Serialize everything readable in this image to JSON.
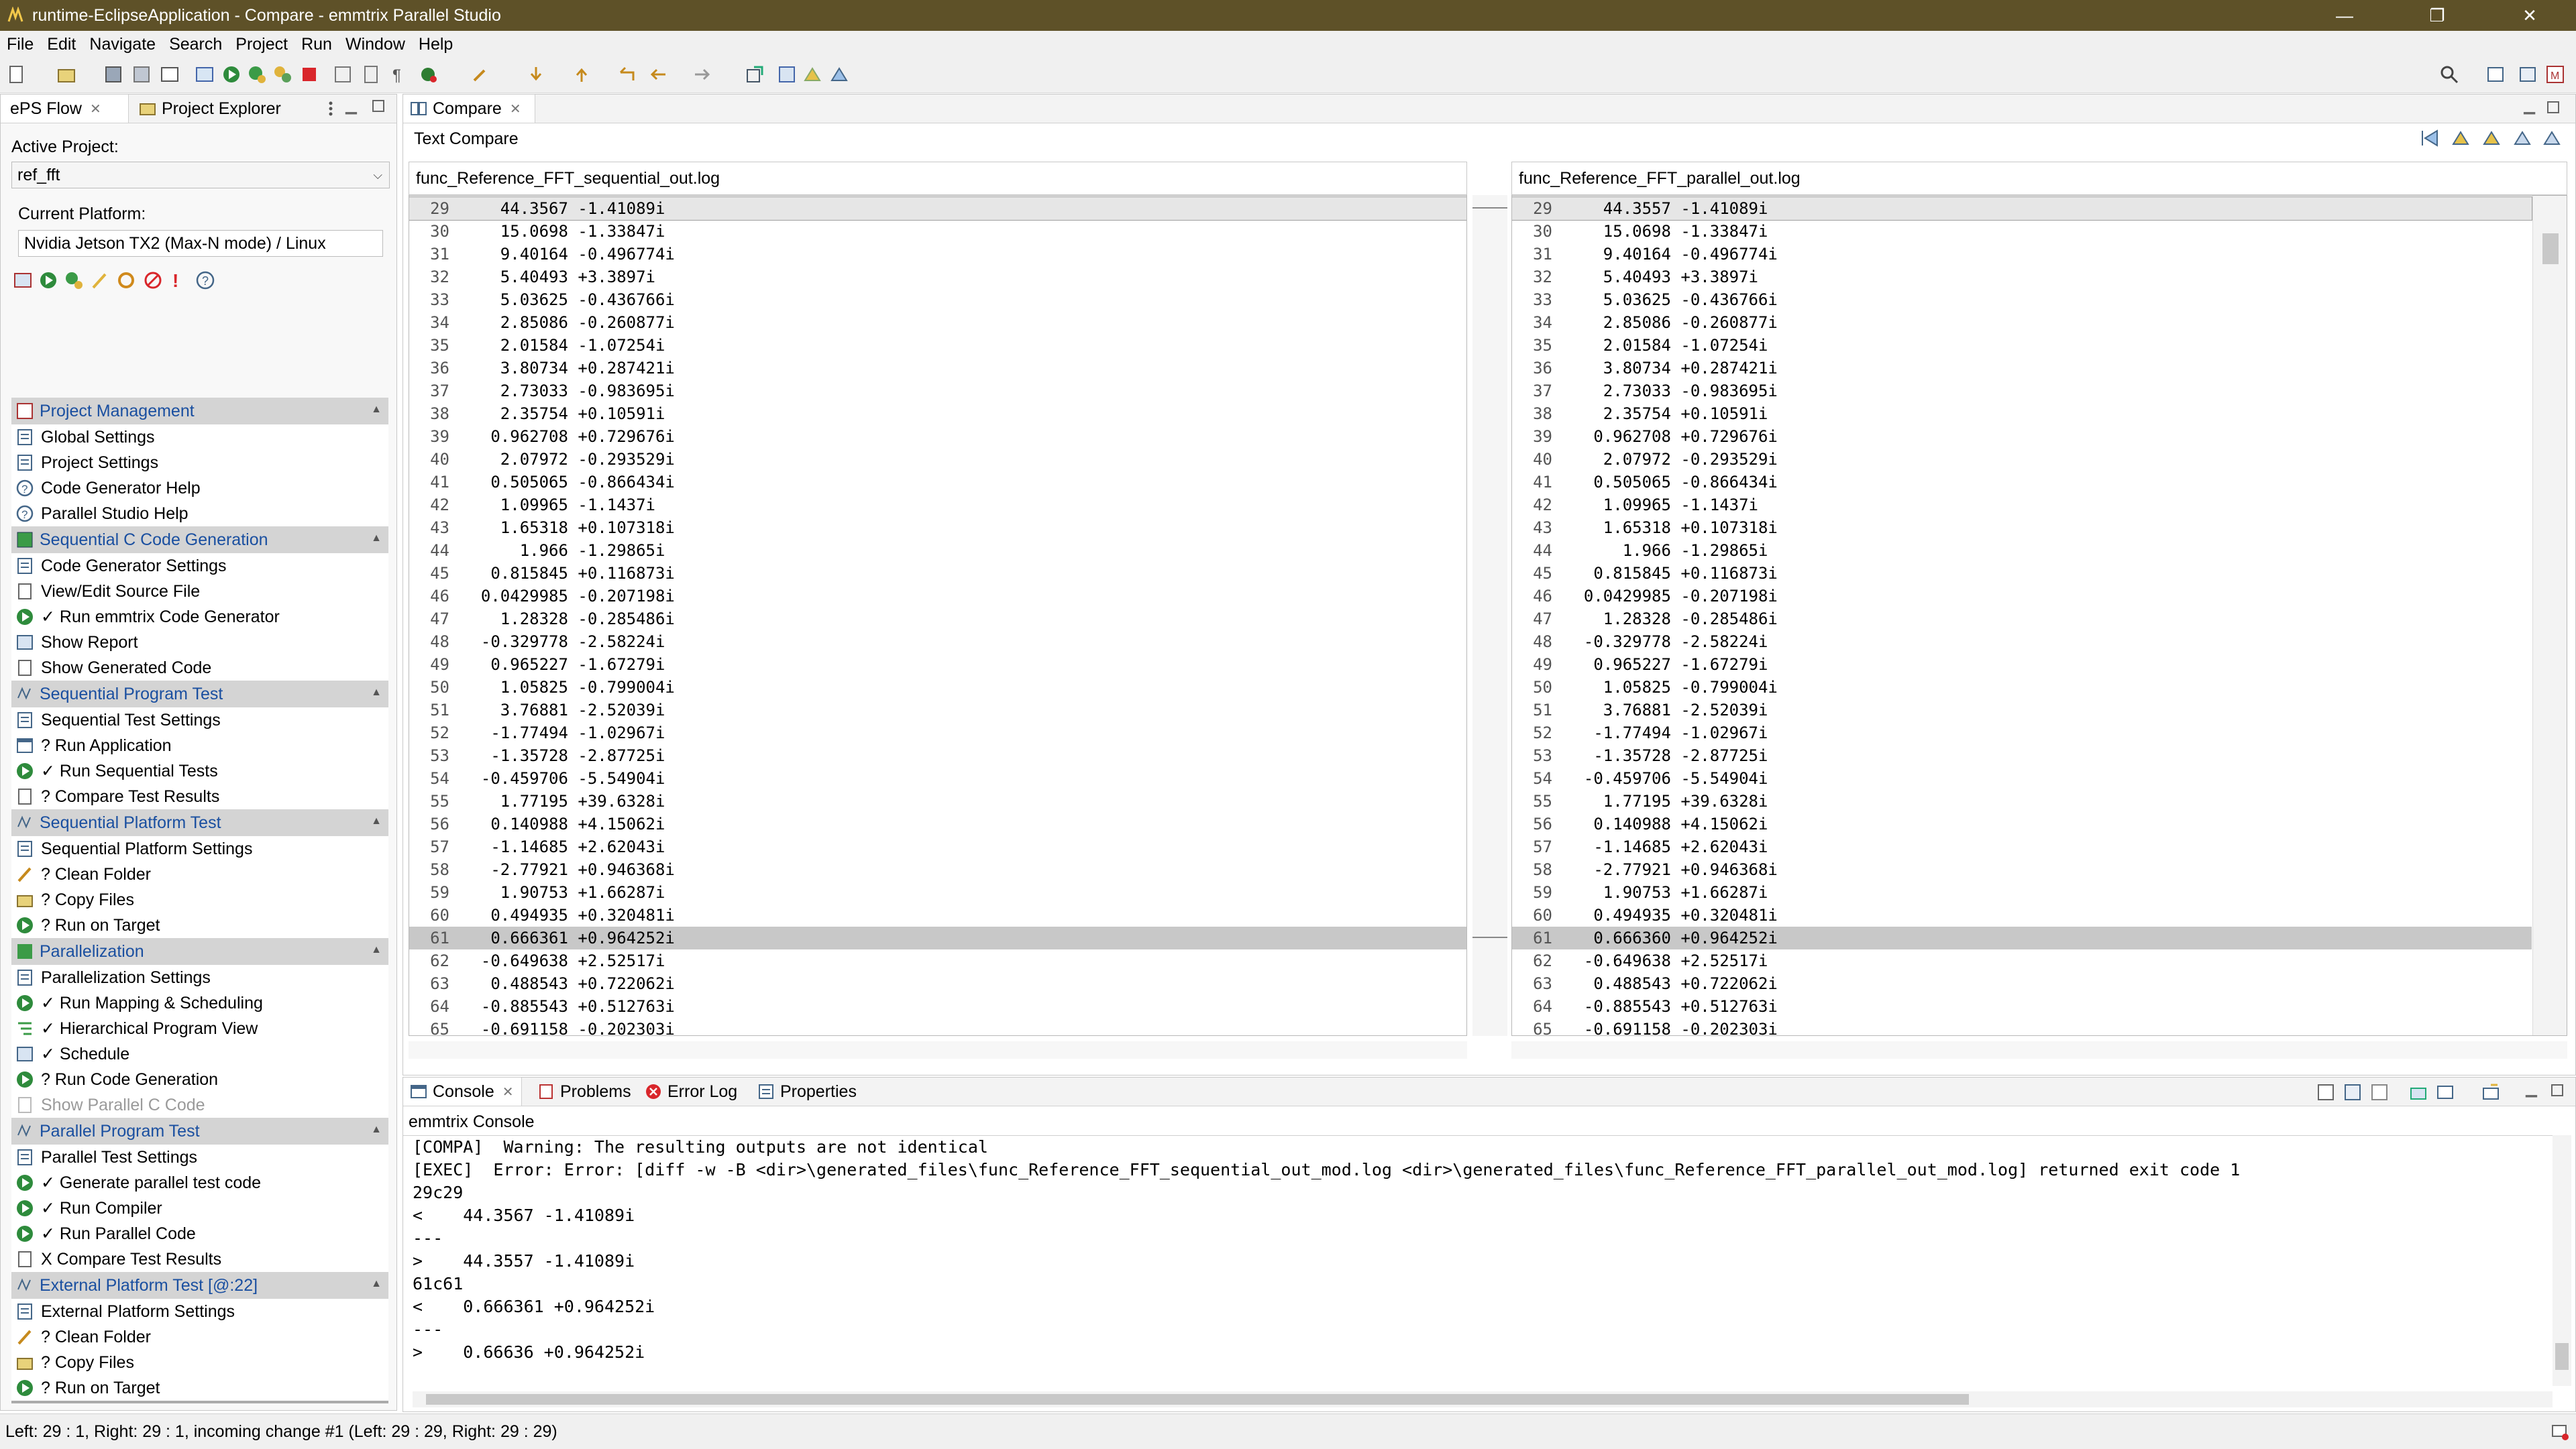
{
  "window": {
    "title": "runtime-EclipseApplication - Compare - emmtrix Parallel Studio",
    "minimize": "—",
    "restore": "❐",
    "close": "✕"
  },
  "menu": [
    "File",
    "Edit",
    "Navigate",
    "Search",
    "Project",
    "Run",
    "Window",
    "Help"
  ],
  "left_panel": {
    "tabs": [
      {
        "label": "ePS Flow"
      },
      {
        "label": "Project Explorer"
      }
    ],
    "active_project_label": "Active Project:",
    "active_project_value": "ref_fft",
    "current_platform_label": "Current Platform:",
    "current_platform_value": "Nvidia Jetson TX2 (Max-N mode) / Linux",
    "sections": [
      {
        "title": "Project Management",
        "items": [
          {
            "label": "Global Settings",
            "icon": "settings-icon"
          },
          {
            "label": "Project Settings",
            "icon": "settings-icon"
          },
          {
            "label": "Code Generator Help",
            "icon": "help-icon"
          },
          {
            "label": "Parallel Studio Help",
            "icon": "help-icon"
          }
        ]
      },
      {
        "title": "Sequential C Code Generation",
        "items": [
          {
            "label": "Code Generator Settings",
            "icon": "settings-icon"
          },
          {
            "label": "View/Edit Source File",
            "icon": "file-icon"
          },
          {
            "label": "✓ Run emmtrix Code Generator",
            "icon": "run-icon"
          },
          {
            "label": "Show Report",
            "icon": "report-icon"
          },
          {
            "label": "Show Generated Code",
            "icon": "file-icon"
          }
        ]
      },
      {
        "title": "Sequential Program Test",
        "items": [
          {
            "label": "Sequential Test Settings",
            "icon": "settings-icon"
          },
          {
            "label": "? Run Application",
            "icon": "app-icon"
          },
          {
            "label": "✓ Run Sequential Tests",
            "icon": "run-icon"
          },
          {
            "label": "? Compare Test Results",
            "icon": "file-icon"
          }
        ]
      },
      {
        "title": "Sequential Platform Test",
        "items": [
          {
            "label": "Sequential Platform Settings",
            "icon": "settings-icon"
          },
          {
            "label": "? Clean Folder",
            "icon": "broom-icon"
          },
          {
            "label": "? Copy Files",
            "icon": "folder-icon"
          },
          {
            "label": "? Run on Target",
            "icon": "run-icon"
          }
        ]
      },
      {
        "title": "Parallelization",
        "items": [
          {
            "label": "Parallelization Settings",
            "icon": "settings-icon"
          },
          {
            "label": "✓ Run Mapping & Scheduling",
            "icon": "run-icon"
          },
          {
            "label": "✓ Hierarchical Program View",
            "icon": "hierarchy-icon"
          },
          {
            "label": "✓ Schedule",
            "icon": "report-icon"
          },
          {
            "label": "? Run Code Generation",
            "icon": "run-icon"
          },
          {
            "label": "Show Parallel C Code",
            "icon": "file-icon",
            "disabled": true
          }
        ]
      },
      {
        "title": "Parallel Program Test",
        "items": [
          {
            "label": "Parallel Test Settings",
            "icon": "settings-icon"
          },
          {
            "label": "✓ Generate parallel test code",
            "icon": "run-icon"
          },
          {
            "label": "✓ Run Compiler",
            "icon": "run-icon"
          },
          {
            "label": "✓ Run Parallel Code",
            "icon": "run-icon"
          },
          {
            "label": "X Compare Test Results",
            "icon": "file-icon"
          }
        ]
      },
      {
        "title": "External Platform Test [@:22]",
        "items": [
          {
            "label": "External Platform Settings",
            "icon": "settings-icon"
          },
          {
            "label": "? Clean Folder",
            "icon": "broom-icon"
          },
          {
            "label": "? Copy Files",
            "icon": "folder-icon"
          },
          {
            "label": "? Run on Target",
            "icon": "run-icon"
          }
        ]
      }
    ]
  },
  "compare": {
    "tab_label": "Compare",
    "header": "Text Compare",
    "left_file": "func_Reference_FFT_sequential_out.log",
    "right_file": "func_Reference_FFT_parallel_out.log",
    "left_lines": [
      {
        "n": "29",
        "t": "    44.3567 -1.41089i"
      },
      {
        "n": "30",
        "t": "    15.0698 -1.33847i"
      },
      {
        "n": "31",
        "t": "    9.40164 -0.496774i"
      },
      {
        "n": "32",
        "t": "    5.40493 +3.3897i"
      },
      {
        "n": "33",
        "t": "    5.03625 -0.436766i"
      },
      {
        "n": "34",
        "t": "    2.85086 -0.260877i"
      },
      {
        "n": "35",
        "t": "    2.01584 -1.07254i"
      },
      {
        "n": "36",
        "t": "    3.80734 +0.287421i"
      },
      {
        "n": "37",
        "t": "    2.73033 -0.983695i"
      },
      {
        "n": "38",
        "t": "    2.35754 +0.10591i"
      },
      {
        "n": "39",
        "t": "   0.962708 +0.729676i"
      },
      {
        "n": "40",
        "t": "    2.07972 -0.293529i"
      },
      {
        "n": "41",
        "t": "   0.505065 -0.866434i"
      },
      {
        "n": "42",
        "t": "    1.09965 -1.1437i"
      },
      {
        "n": "43",
        "t": "    1.65318 +0.107318i"
      },
      {
        "n": "44",
        "t": "      1.966 -1.29865i"
      },
      {
        "n": "45",
        "t": "   0.815845 +0.116873i"
      },
      {
        "n": "46",
        "t": "  0.0429985 -0.207198i"
      },
      {
        "n": "47",
        "t": "    1.28328 -0.285486i"
      },
      {
        "n": "48",
        "t": "  -0.329778 -2.58224i"
      },
      {
        "n": "49",
        "t": "   0.965227 -1.67279i"
      },
      {
        "n": "50",
        "t": "    1.05825 -0.799004i"
      },
      {
        "n": "51",
        "t": "    3.76881 -2.52039i"
      },
      {
        "n": "52",
        "t": "   -1.77494 -1.02967i"
      },
      {
        "n": "53",
        "t": "   -1.35728 -2.87725i"
      },
      {
        "n": "54",
        "t": "  -0.459706 -5.54904i"
      },
      {
        "n": "55",
        "t": "    1.77195 +39.6328i"
      },
      {
        "n": "56",
        "t": "   0.140988 +4.15062i"
      },
      {
        "n": "57",
        "t": "   -1.14685 +2.62043i"
      },
      {
        "n": "58",
        "t": "   -2.77921 +0.946368i"
      },
      {
        "n": "59",
        "t": "    1.90753 +1.66287i"
      },
      {
        "n": "60",
        "t": "   0.494935 +0.320481i"
      },
      {
        "n": "61",
        "t": "   0.666361 +0.964252i"
      },
      {
        "n": "62",
        "t": "  -0.649638 +2.52517i"
      },
      {
        "n": "63",
        "t": "   0.488543 +0.722062i"
      },
      {
        "n": "64",
        "t": "  -0.885543 +0.512763i"
      },
      {
        "n": "65",
        "t": "  -0.691158 -0.202303i"
      }
    ],
    "right_lines": [
      {
        "n": "29",
        "t": "    44.3557 -1.41089i"
      },
      {
        "n": "30",
        "t": "    15.0698 -1.33847i"
      },
      {
        "n": "31",
        "t": "    9.40164 -0.496774i"
      },
      {
        "n": "32",
        "t": "    5.40493 +3.3897i"
      },
      {
        "n": "33",
        "t": "    5.03625 -0.436766i"
      },
      {
        "n": "34",
        "t": "    2.85086 -0.260877i"
      },
      {
        "n": "35",
        "t": "    2.01584 -1.07254i"
      },
      {
        "n": "36",
        "t": "    3.80734 +0.287421i"
      },
      {
        "n": "37",
        "t": "    2.73033 -0.983695i"
      },
      {
        "n": "38",
        "t": "    2.35754 +0.10591i"
      },
      {
        "n": "39",
        "t": "   0.962708 +0.729676i"
      },
      {
        "n": "40",
        "t": "    2.07972 -0.293529i"
      },
      {
        "n": "41",
        "t": "   0.505065 -0.866434i"
      },
      {
        "n": "42",
        "t": "    1.09965 -1.1437i"
      },
      {
        "n": "43",
        "t": "    1.65318 +0.107318i"
      },
      {
        "n": "44",
        "t": "      1.966 -1.29865i"
      },
      {
        "n": "45",
        "t": "   0.815845 +0.116873i"
      },
      {
        "n": "46",
        "t": "  0.0429985 -0.207198i"
      },
      {
        "n": "47",
        "t": "    1.28328 -0.285486i"
      },
      {
        "n": "48",
        "t": "  -0.329778 -2.58224i"
      },
      {
        "n": "49",
        "t": "   0.965227 -1.67279i"
      },
      {
        "n": "50",
        "t": "    1.05825 -0.799004i"
      },
      {
        "n": "51",
        "t": "    3.76881 -2.52039i"
      },
      {
        "n": "52",
        "t": "   -1.77494 -1.02967i"
      },
      {
        "n": "53",
        "t": "   -1.35728 -2.87725i"
      },
      {
        "n": "54",
        "t": "  -0.459706 -5.54904i"
      },
      {
        "n": "55",
        "t": "    1.77195 +39.6328i"
      },
      {
        "n": "56",
        "t": "   0.140988 +4.15062i"
      },
      {
        "n": "57",
        "t": "   -1.14685 +2.62043i"
      },
      {
        "n": "58",
        "t": "   -2.77921 +0.946368i"
      },
      {
        "n": "59",
        "t": "    1.90753 +1.66287i"
      },
      {
        "n": "60",
        "t": "   0.494935 +0.320481i"
      },
      {
        "n": "61",
        "t": "   0.666360 +0.964252i"
      },
      {
        "n": "62",
        "t": "  -0.649638 +2.52517i"
      },
      {
        "n": "63",
        "t": "   0.488543 +0.722062i"
      },
      {
        "n": "64",
        "t": "  -0.885543 +0.512763i"
      },
      {
        "n": "65",
        "t": "  -0.691158 -0.202303i"
      }
    ]
  },
  "console": {
    "tabs": [
      {
        "label": "Console",
        "icon": "console-icon"
      },
      {
        "label": "Problems",
        "icon": "problems-icon"
      },
      {
        "label": "Error Log",
        "icon": "error-log-icon"
      },
      {
        "label": "Properties",
        "icon": "properties-icon"
      }
    ],
    "title": "emmtrix Console",
    "lines": [
      "[COMPA]  Warning: The resulting outputs are not identical",
      "[EXEC]  Error: Error: [diff -w -B <dir>\\generated_files\\func_Reference_FFT_sequential_out_mod.log <dir>\\generated_files\\func_Reference_FFT_parallel_out_mod.log] returned exit code 1",
      "29c29",
      "<    44.3567 -1.41089i",
      "---",
      ">    44.3557 -1.41089i",
      "61c61",
      "<    0.666361 +0.964252i",
      "---",
      ">    0.66636 +0.964252i"
    ]
  },
  "status": {
    "text": "Left: 29 : 1, Right: 29 : 1, incoming change #1 (Left: 29 : 29, Right: 29 : 29)"
  },
  "colors": {
    "titlebar": "#5e5128",
    "section_title": "#1a4fa0",
    "run_green": "#2e8b3c",
    "stop_red": "#d9262b"
  }
}
